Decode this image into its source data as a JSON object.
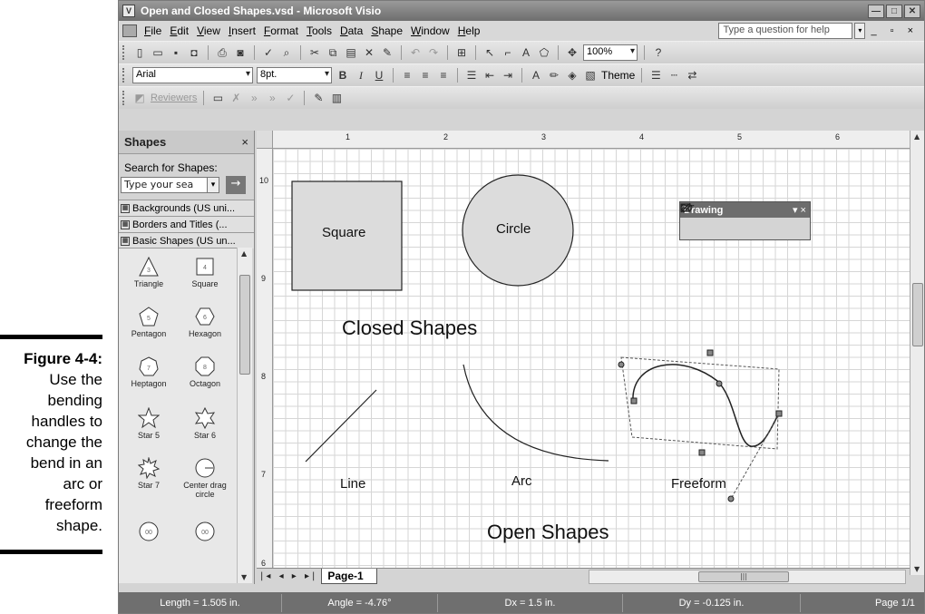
{
  "caption": {
    "figure": "Figure 4-4:",
    "lines": [
      "Use the",
      "bending",
      "handles to",
      "change the",
      "bend in an",
      "arc or",
      "freeform",
      "shape."
    ]
  },
  "window": {
    "title": "Open and Closed Shapes.vsd - Microsoft Visio",
    "controls": {
      "minimize": "—",
      "maximize": "□",
      "close": "✕"
    }
  },
  "menu": {
    "items": [
      "File",
      "Edit",
      "View",
      "Insert",
      "Format",
      "Tools",
      "Data",
      "Shape",
      "Window",
      "Help"
    ],
    "help_placeholder": "Type a question for help"
  },
  "toolbar_standard": {
    "zoom": "100%"
  },
  "toolbar_format": {
    "font": "Arial",
    "size": "8pt.",
    "bold": "B",
    "italic": "I",
    "underline": "U",
    "theme": "Theme"
  },
  "toolbar_review": {
    "reviewers": "Reviewers"
  },
  "shapes_pane": {
    "title": "Shapes",
    "close": "×",
    "search_label": "Search for Shapes:",
    "search_value": "Type your sea",
    "go": "→",
    "stencils": [
      "Backgrounds (US uni...",
      "Borders and Titles (...",
      "Basic Shapes (US un..."
    ],
    "shapes": [
      {
        "name": "Triangle",
        "glyph": "3"
      },
      {
        "name": "Square",
        "glyph": "4"
      },
      {
        "name": "Pentagon",
        "glyph": "5"
      },
      {
        "name": "Hexagon",
        "glyph": "6"
      },
      {
        "name": "Heptagon",
        "glyph": "7"
      },
      {
        "name": "Octagon",
        "glyph": "8"
      },
      {
        "name": "Star 5",
        "glyph": ""
      },
      {
        "name": "Star 6",
        "glyph": ""
      },
      {
        "name": "Star 7",
        "glyph": ""
      },
      {
        "name": "Center drag circle",
        "glyph": ""
      },
      {
        "name": "",
        "glyph": "00"
      },
      {
        "name": "",
        "glyph": "00"
      }
    ]
  },
  "rulers": {
    "top": [
      "1",
      "2",
      "3",
      "4",
      "5",
      "6"
    ],
    "left": [
      "10",
      "9",
      "8",
      "7",
      "6"
    ]
  },
  "canvas": {
    "square_label": "Square",
    "circle_label": "Circle",
    "closed_title": "Closed Shapes",
    "line_label": "Line",
    "arc_label": "Arc",
    "freeform_label": "Freeform",
    "open_title": "Open Shapes"
  },
  "drawing_toolbar": {
    "title": "Drawing",
    "controls": "▾ ×"
  },
  "tabs": {
    "page": "Page-1"
  },
  "status": {
    "length": "Length = 1.505 in.",
    "angle": "Angle = -4.76°",
    "dx": "Dx = 1.5 in.",
    "dy": "Dy = -0.125 in.",
    "page": "Page 1/1"
  }
}
